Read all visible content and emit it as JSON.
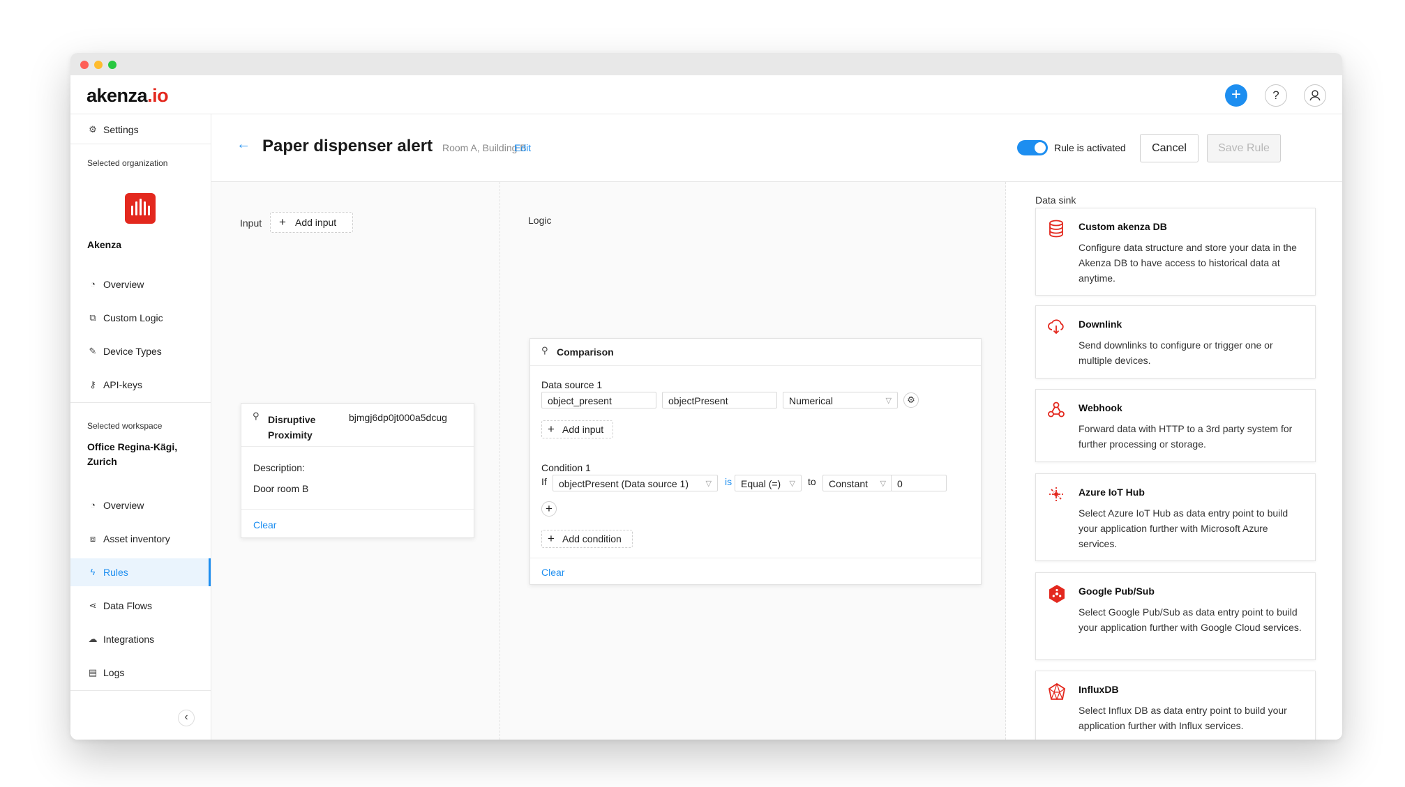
{
  "app": {
    "logo_main": "akenza",
    "logo_suffix": ".io"
  },
  "topbar": {
    "add_icon": "+",
    "help_icon": "?"
  },
  "sidebar": {
    "settings": "Settings",
    "org_caption": "Selected organization",
    "org_name": "Akenza",
    "org_items": [
      "Overview",
      "Custom Logic",
      "Device Types",
      "API-keys"
    ],
    "workspace_caption": "Selected workspace",
    "workspace_name": "Office Regina-Kägi, Zurich",
    "workspace_items": [
      "Overview",
      "Asset inventory",
      "Rules",
      "Data Flows",
      "Integrations",
      "Logs"
    ],
    "collapse_icon": "‹"
  },
  "header": {
    "back_icon": "←",
    "title": "Paper dispenser alert",
    "subtitle": "Room A, Building B",
    "edit": "Edit",
    "toggle_label": "Rule is activated",
    "cancel": "Cancel",
    "save": "Save Rule"
  },
  "input": {
    "label": "Input",
    "add_input": "Add input",
    "device_name": "Disruptive Proximity",
    "device_id": "bjmgj6dp0jt000a5dcug",
    "desc_label": "Description:",
    "desc_value": "Door room B",
    "clear": "Clear"
  },
  "logic": {
    "label": "Logic",
    "card_title": "Comparison",
    "ds_label": "Data source 1",
    "ds_field1": "object_present",
    "ds_field2": "objectPresent",
    "ds_type": "Numerical",
    "add_input": "Add input",
    "cond_label": "Condition 1",
    "if": "If",
    "cond_source": "objectPresent (Data source 1)",
    "is": "is",
    "operator": "Equal (=)",
    "to": "to",
    "value_type": "Constant",
    "value": "0",
    "plus": "+",
    "add_condition": "Add condition",
    "clear": "Clear"
  },
  "sink": {
    "label": "Data sink",
    "items": [
      {
        "title": "Custom akenza DB",
        "desc": "Configure data structure and store your data in the Akenza DB to have access to historical data at anytime."
      },
      {
        "title": "Downlink",
        "desc": "Send downlinks to configure or trigger one or multiple devices."
      },
      {
        "title": "Webhook",
        "desc": "Forward data with HTTP to a 3rd party system for further processing or storage."
      },
      {
        "title": "Azure IoT Hub",
        "desc": "Select Azure IoT Hub as data entry point to build your application further with Microsoft Azure services."
      },
      {
        "title": "Google Pub/Sub",
        "desc": "Select Google Pub/Sub as data entry point to build your application further with Google Cloud services."
      },
      {
        "title": "InfluxDB",
        "desc": "Select Influx DB as data entry point to build your application further with Influx services."
      }
    ]
  },
  "colors": {
    "accent": "#1d8ef0",
    "brand": "#e3281e"
  }
}
